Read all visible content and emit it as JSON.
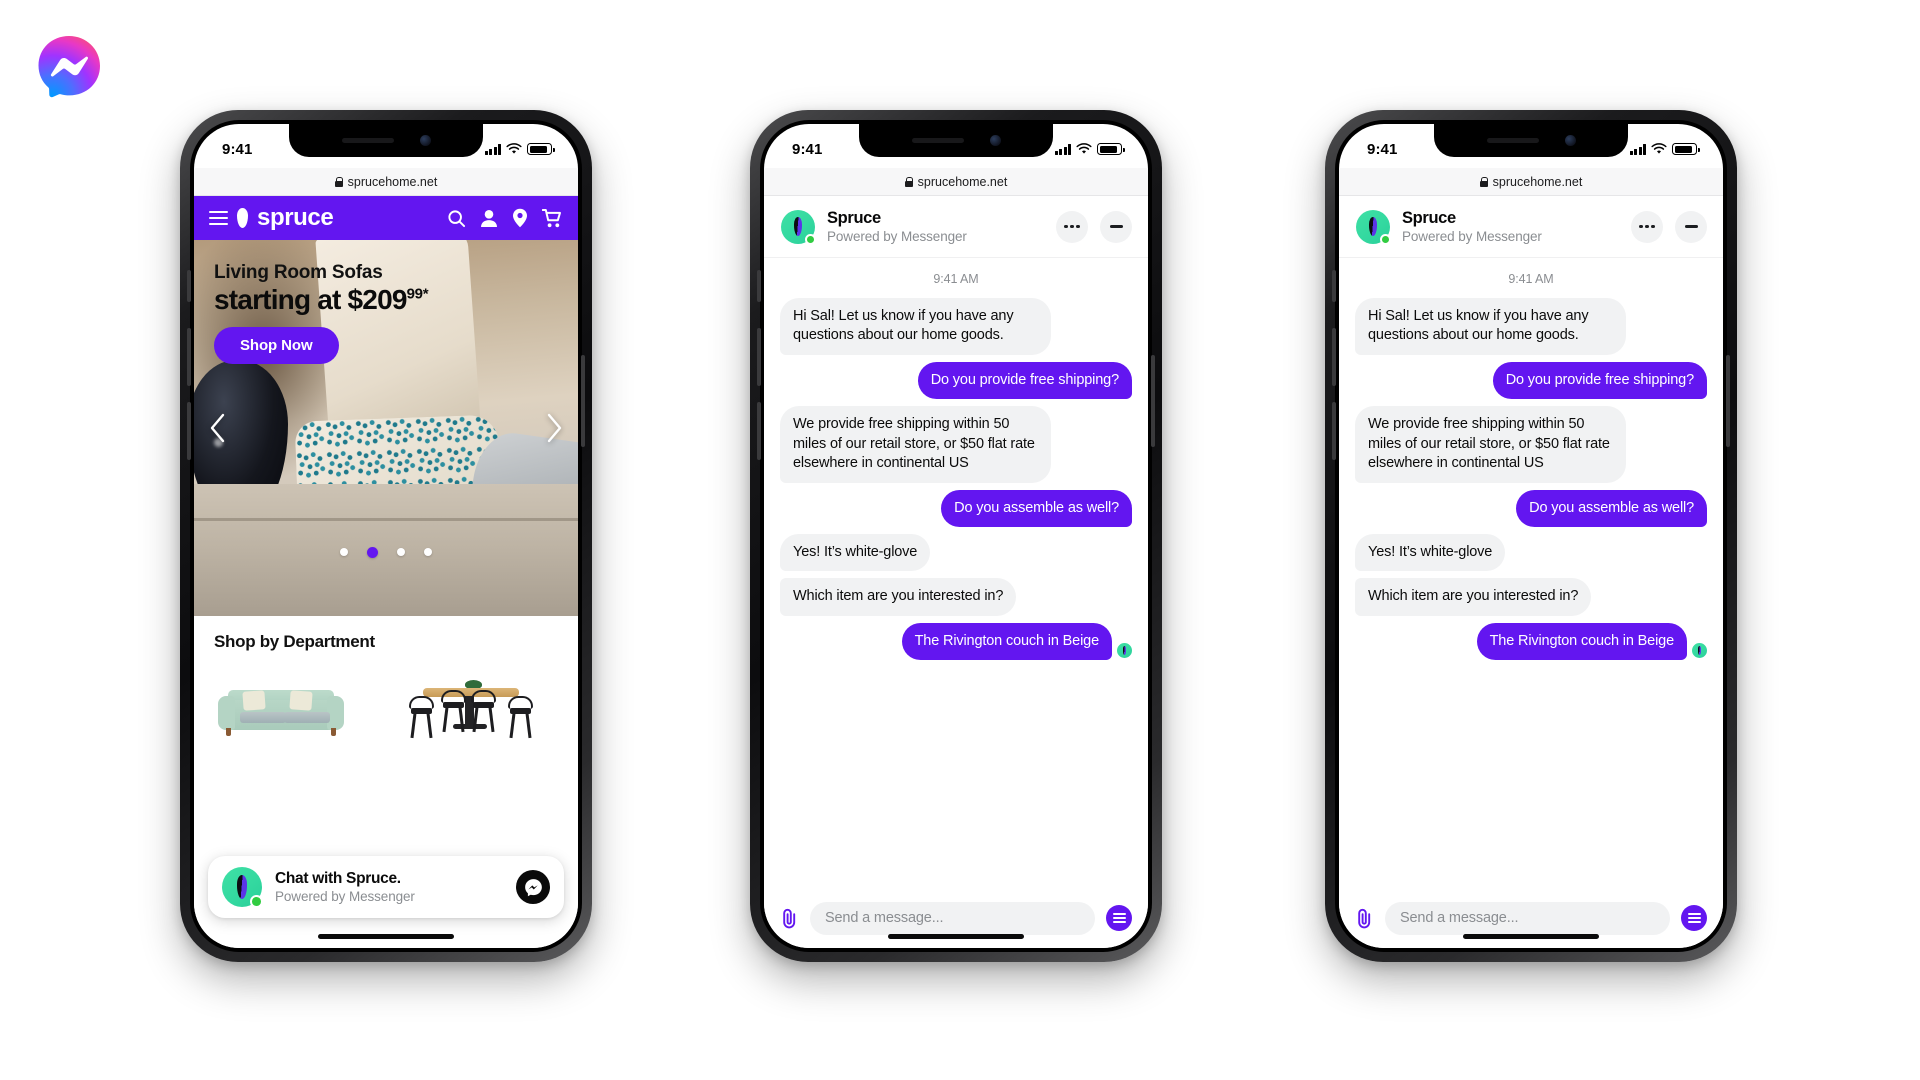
{
  "brand": {
    "logo_name": "messenger-logo"
  },
  "status_bar": {
    "time": "9:41",
    "signal_icon": "signal-bars-icon",
    "wifi_icon": "wifi-icon",
    "battery_icon": "battery-icon"
  },
  "browser": {
    "url": "sprucehome.net",
    "lock_icon": "lock-icon"
  },
  "site": {
    "nav": {
      "menu_icon": "hamburger-menu-icon",
      "logo_mark": "spruce-leaf-icon",
      "wordmark": "spruce",
      "icons": [
        "search-icon",
        "account-icon",
        "location-pin-icon",
        "shopping-cart-icon"
      ],
      "background": "#6316F0"
    },
    "hero": {
      "line1": "Living Room Sofas",
      "line2_main": "starting at $209",
      "line2_sup": "99*",
      "cta": "Shop Now",
      "prev_icon": "chevron-left-icon",
      "next_icon": "chevron-right-icon",
      "dots_total": 4,
      "dot_active_index": 1
    },
    "department": {
      "heading": "Shop by Department",
      "items": [
        {
          "name": "sofa-product-image"
        },
        {
          "name": "dining-set-product-image"
        }
      ]
    },
    "chat_prompt": {
      "title": "Chat with Spruce.",
      "subtitle": "Powered by Messenger",
      "avatar_name": "spruce-avatar",
      "button_icon": "messenger-icon"
    }
  },
  "chat": {
    "header": {
      "name": "Spruce",
      "subtitle": "Powered by Messenger",
      "avatar_name": "spruce-avatar",
      "more_icon": "more-options-icon",
      "minimize_icon": "minimize-icon"
    },
    "timestamp": "9:41 AM",
    "messages": [
      {
        "from": "in",
        "text": "Hi Sal! Let us know if you have any questions about our home goods."
      },
      {
        "from": "out",
        "text": "Do you provide free shipping?"
      },
      {
        "from": "in",
        "text": "We provide free shipping within 50 miles of our retail store, or $50 flat rate elsewhere in continental US"
      },
      {
        "from": "out",
        "text": "Do you assemble as well?"
      },
      {
        "from": "in",
        "text": "Yes! It’s white-glove"
      },
      {
        "from": "in",
        "text": "Which item are you interested in?"
      },
      {
        "from": "out",
        "text": "The Rivington couch in Beige",
        "seen": true
      }
    ],
    "composer": {
      "attach_icon": "paperclip-icon",
      "placeholder": "Send a message...",
      "menu_icon": "menu-icon"
    },
    "colors": {
      "accent": "#6316F0",
      "incoming_bubble": "#f1f2f3",
      "avatar_green": "#3FE0A5",
      "online_green": "#31CC41"
    }
  }
}
